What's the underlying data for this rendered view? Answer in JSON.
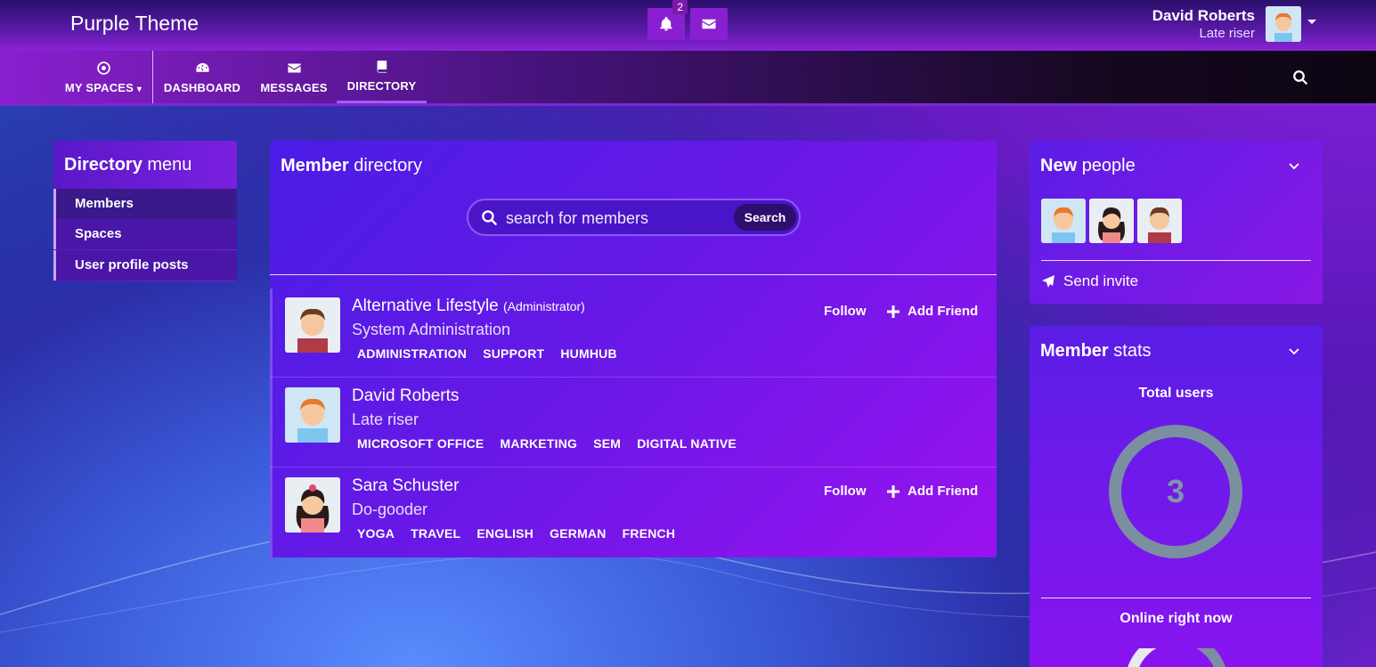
{
  "header": {
    "brand": "Purple Theme",
    "notification_count": "2"
  },
  "user": {
    "name": "David Roberts",
    "status": "Late riser"
  },
  "nav": {
    "items": [
      {
        "label": "MY SPACES",
        "icon": "target-icon"
      },
      {
        "label": "DASHBOARD",
        "icon": "dashboard-icon"
      },
      {
        "label": "MESSAGES",
        "icon": "envelope-icon"
      },
      {
        "label": "DIRECTORY",
        "icon": "book-icon"
      }
    ]
  },
  "directory_menu": {
    "title_bold": "Directory",
    "title_rest": "menu",
    "items": [
      "Members",
      "Spaces",
      "User profile posts"
    ]
  },
  "member_directory": {
    "title_bold": "Member",
    "title_rest": "directory",
    "search_placeholder": "search for members",
    "search_button": "Search",
    "follow_label": "Follow",
    "add_friend_label": "Add Friend",
    "members": [
      {
        "name": "Alternative Lifestyle",
        "role": "(Administrator)",
        "title": "System Administration",
        "tags": [
          "ADMINISTRATION",
          "SUPPORT",
          "HUMHUB"
        ]
      },
      {
        "name": "David Roberts",
        "role": "",
        "title": "Late riser",
        "tags": [
          "MICROSOFT OFFICE",
          "MARKETING",
          "SEM",
          "DIGITAL NATIVE"
        ]
      },
      {
        "name": "Sara Schuster",
        "role": "",
        "title": "Do-gooder",
        "tags": [
          "YOGA",
          "TRAVEL",
          "ENGLISH",
          "GERMAN",
          "FRENCH"
        ]
      }
    ]
  },
  "new_people": {
    "title_bold": "New",
    "title_rest": "people",
    "invite_label": "Send invite"
  },
  "member_stats": {
    "title_bold": "Member",
    "title_rest": "stats",
    "total_label": "Total users",
    "total_value": "3",
    "online_label": "Online right now"
  },
  "colors": {
    "accent": "#8a23d6",
    "ring": "#7a8fa0"
  }
}
